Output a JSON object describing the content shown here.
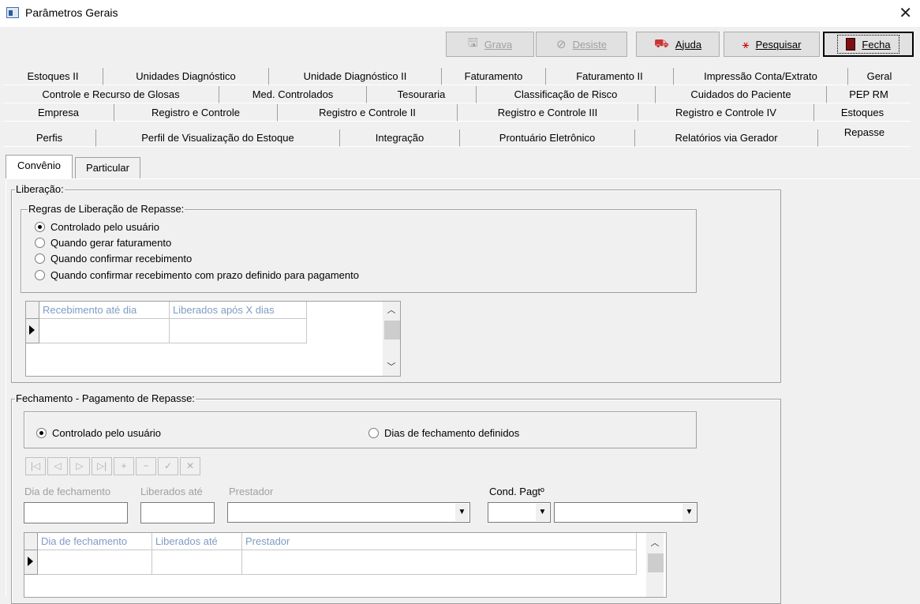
{
  "window": {
    "title": "Parâmetros Gerais",
    "close_symbol": "✕"
  },
  "toolbar": {
    "grava": {
      "label": "Grava",
      "icon": "save-icon"
    },
    "desiste": {
      "label": "Desiste",
      "icon": "cancel-icon"
    },
    "ajuda": {
      "label": "Ajuda",
      "icon": "help-icon"
    },
    "pesquisar": {
      "label": "Pesquisar",
      "icon": "search-icon"
    },
    "fecha": {
      "label": "Fecha",
      "icon": "close-door-icon"
    }
  },
  "tabs": {
    "row1": [
      "Estoques II",
      "Unidades Diagnóstico",
      "Unidade Diagnóstico II",
      "Faturamento",
      "Faturamento II",
      "Impressão Conta/Extrato",
      "Geral"
    ],
    "row2": [
      "Controle e Recurso de Glosas",
      "Med. Controlados",
      "Tesouraria",
      "Classificação de Risco",
      "Cuidados do Paciente",
      "PEP RM"
    ],
    "row3": [
      "Empresa",
      "Registro e Controle",
      "Registro e Controle II",
      "Registro e Controle III",
      "Registro e Controle IV",
      "Estoques"
    ],
    "row4": [
      "Perfis",
      "Perfil de Visualização do Estoque",
      "Integração",
      "Prontuário Eletrônico",
      "Relatórios via Gerador",
      "Repasse"
    ]
  },
  "subtabs": [
    "Convênio",
    "Particular"
  ],
  "liberacao": {
    "legend": "Liberação:",
    "regras_legend": "Regras de Liberação de Repasse:",
    "options": [
      {
        "label": "Controlado pelo usuário",
        "checked": true
      },
      {
        "label": "Quando gerar faturamento",
        "checked": false
      },
      {
        "label": "Quando confirmar recebimento",
        "checked": false
      },
      {
        "label": "Quando confirmar recebimento com prazo definido para pagamento",
        "checked": false
      }
    ],
    "grid_columns": [
      "Recebimento até dia",
      "Liberados após X dias"
    ]
  },
  "fechamento": {
    "legend": "Fechamento - Pagamento de Repasse:",
    "options": [
      {
        "label": "Controlado pelo usuário",
        "checked": true
      },
      {
        "label": "Dias de fechamento definidos",
        "checked": false
      }
    ],
    "fields": {
      "dia_fechamento": "Dia de fechamento",
      "liberados_ate": "Liberados até",
      "prestador": "Prestador",
      "cond_pagto": "Cond. Pagtº"
    },
    "grid_columns": [
      "Dia de fechamento",
      "Liberados até",
      "Prestador"
    ]
  }
}
